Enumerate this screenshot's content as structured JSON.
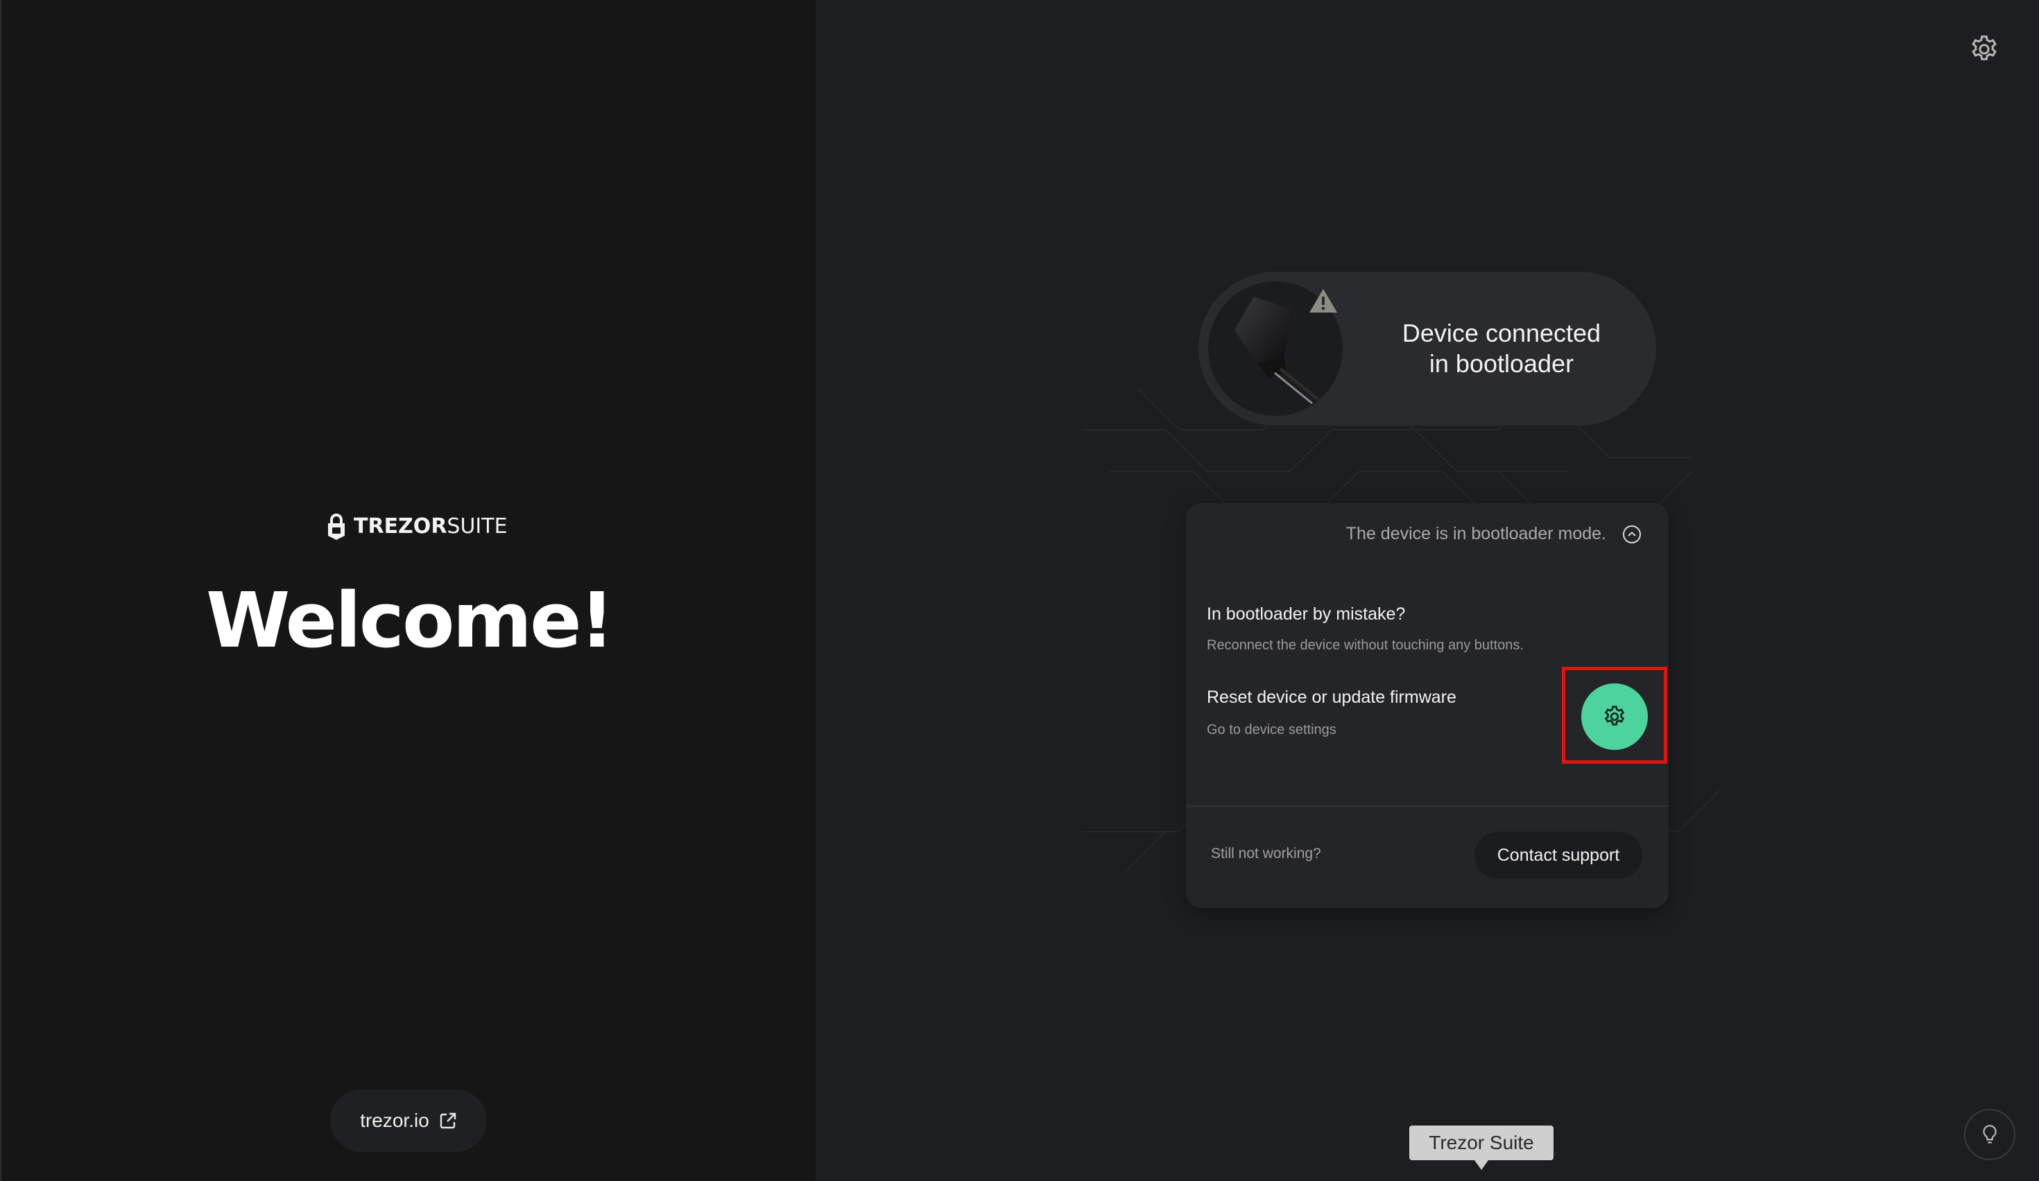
{
  "brand": {
    "name_bold": "TREZOR",
    "name_light": "SUITE",
    "accent_color": "#4dd39e"
  },
  "welcome": {
    "title": "Welcome!"
  },
  "footer": {
    "site_link_label": "trezor.io",
    "site_link_icon": "external-link-icon"
  },
  "header": {
    "settings_icon": "gear-icon"
  },
  "device_status": {
    "title": "Device connected\nin bootloader",
    "warning_icon": "warning-triangle-icon"
  },
  "bootloader_card": {
    "header": "The device is in bootloader mode.",
    "items": [
      {
        "title": "In bootloader by mistake?",
        "subtitle": "Reconnect the device without touching any buttons."
      },
      {
        "title": "Reset device or update firmware",
        "subtitle": "Go to device settings"
      }
    ],
    "settings_button_icon": "gear-icon",
    "footer_text": "Still not working?",
    "contact_button_label": "Contact support"
  },
  "tooltip": {
    "label": "Trezor Suite"
  },
  "help": {
    "icon": "lightbulb-icon"
  }
}
